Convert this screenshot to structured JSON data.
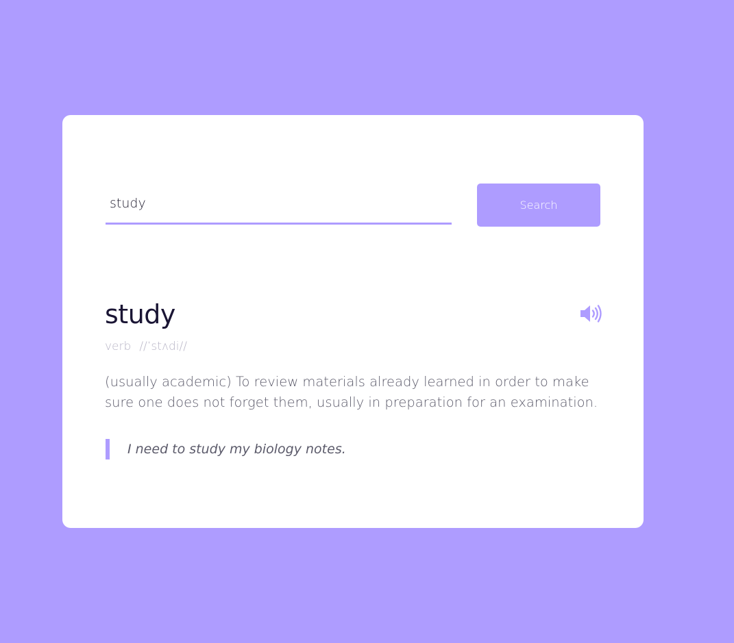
{
  "search": {
    "value": "study",
    "button_label": "Search"
  },
  "result": {
    "word": "study",
    "part_of_speech": "verb",
    "phonetic": "//ˈstʌdi//",
    "definition": "(usually academic) To review materials already learned in order to make sure one does not forget them, usually in preparation for an examination.",
    "example": "I need to study my biology notes.",
    "audio_icon": "speaker-volume-icon"
  },
  "colors": {
    "background": "#ae9cff",
    "accent": "#ae9cff",
    "card": "#ffffff",
    "word_text": "#1a1534",
    "muted_text": "#b9b6c7",
    "body_text": "#5b5a6a"
  }
}
